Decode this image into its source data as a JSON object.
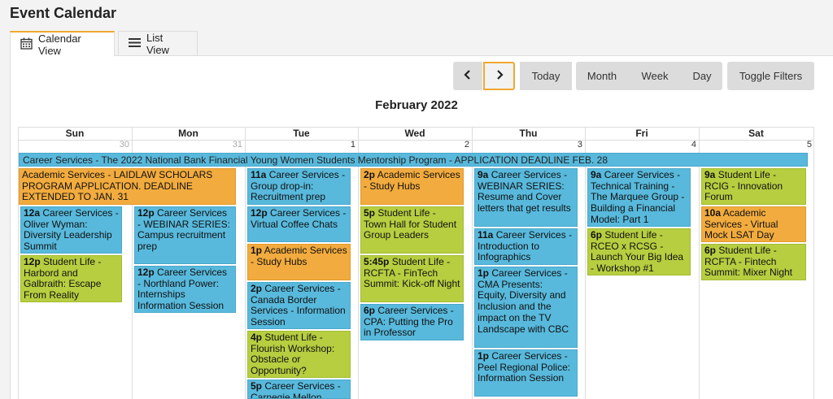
{
  "page": {
    "title": "Event Calendar"
  },
  "tabs": {
    "calendar_view": "Calendar View",
    "list_view": "List View"
  },
  "toolbar": {
    "today": "Today",
    "month": "Month",
    "week": "Week",
    "day": "Day",
    "toggle_filters": "Toggle Filters"
  },
  "calendar": {
    "month_title": "February 2022",
    "day_names": [
      "Sun",
      "Mon",
      "Tue",
      "Wed",
      "Thu",
      "Fri",
      "Sat"
    ],
    "dates": [
      "30",
      "31",
      "1",
      "2",
      "3",
      "4",
      "5"
    ],
    "banner": "Career Services - The 2022 National Bank Financial Young Women Students Mentorship Program - APPLICATION DEADLINE FEB. 28",
    "events": {
      "sun": [
        {
          "time": "",
          "text": "Academic Services - LAIDLAW SCHOLARS PROGRAM APPLICATION. DEADLINE EXTENDED TO JAN. 31",
          "color": "orange"
        },
        {
          "time": "12a",
          "text": "Career Services - Oliver Wyman: Diversity Leadership Summit",
          "color": "blue"
        },
        {
          "time": "12p",
          "text": "Student Life - Harbord and Galbraith: Escape From Reality",
          "color": "green"
        }
      ],
      "mon": [
        {
          "time": "12p",
          "text": "Career Services - WEBINAR SERIES: Campus recruitment prep",
          "color": "blue"
        },
        {
          "time": "12p",
          "text": "Career Services - Northland Power: Internships Information Session",
          "color": "blue"
        }
      ],
      "tue": [
        {
          "time": "11a",
          "text": "Career Services - Group drop-in: Recruitment prep",
          "color": "blue"
        },
        {
          "time": "12p",
          "text": "Career Services - Virtual Coffee Chats",
          "color": "blue"
        },
        {
          "time": "1p",
          "text": "Academic Services - Study Hubs",
          "color": "orange"
        },
        {
          "time": "2p",
          "text": "Career Services - Canada Border Services - Information Session",
          "color": "blue"
        },
        {
          "time": "4p",
          "text": "Student Life - Flourish Workshop: Obstacle or Opportunity?",
          "color": "green"
        },
        {
          "time": "5p",
          "text": "Career Services - Carnegie Mellon",
          "color": "blue"
        }
      ],
      "wed": [
        {
          "time": "2p",
          "text": "Academic Services - Study Hubs",
          "color": "orange"
        },
        {
          "time": "5p",
          "text": "Student Life - Town Hall for Student Group Leaders",
          "color": "green"
        },
        {
          "time": "5:45p",
          "text": "Student Life - RCFTA - FinTech Summit: Kick-off Night",
          "color": "green"
        },
        {
          "time": "6p",
          "text": "Career Services - CPA: Putting the Pro in Professor",
          "color": "blue"
        }
      ],
      "thu": [
        {
          "time": "9a",
          "text": "Career Services - WEBINAR SERIES: Resume and Cover letters that get results",
          "color": "blue"
        },
        {
          "time": "11a",
          "text": "Career Services - Introduction to Infographics",
          "color": "blue"
        },
        {
          "time": "1p",
          "text": "Career Services - CMA Presents: Equity, Diversity and Inclusion and the impact on the TV Landscape with CBC",
          "color": "blue"
        },
        {
          "time": "1p",
          "text": "Career Services - Peel Regional Police: Information Session",
          "color": "blue"
        }
      ],
      "fri": [
        {
          "time": "9a",
          "text": "Career Services - Technical Training - The Marquee Group - Building a Financial Model: Part 1",
          "color": "blue"
        },
        {
          "time": "6p",
          "text": "Student Life - RCEO x RCSG - Launch Your Big Idea - Workshop #1",
          "color": "green"
        }
      ],
      "sat": [
        {
          "time": "9a",
          "text": "Student Life - RCIG - Innovation Forum",
          "color": "green"
        },
        {
          "time": "10a",
          "text": "Academic Services - Virtual Mock LSAT Day",
          "color": "orange"
        },
        {
          "time": "6p",
          "text": "Student Life - RCFTA - Fintech Summit: Mixer Night",
          "color": "green"
        }
      ]
    }
  }
}
